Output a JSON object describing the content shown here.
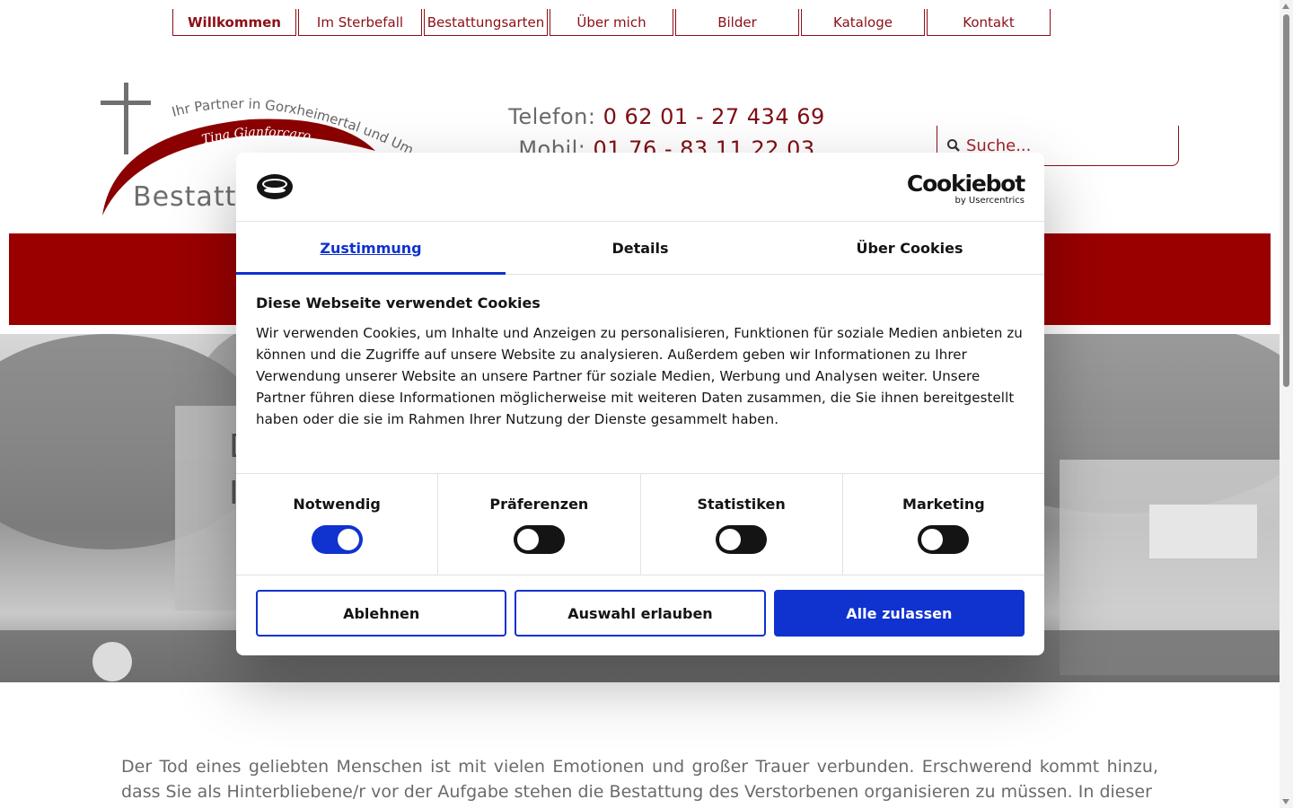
{
  "nav": {
    "items": [
      {
        "label": "Willkommen",
        "active": true
      },
      {
        "label": "Im Sterbefall",
        "active": false
      },
      {
        "label": "Bestattungsarten",
        "active": false
      },
      {
        "label": "Über mich",
        "active": false
      },
      {
        "label": "Bilder",
        "active": false
      },
      {
        "label": "Kataloge",
        "active": false
      },
      {
        "label": "Kontakt",
        "active": false
      }
    ]
  },
  "header": {
    "logo_tagline": "Ihr Partner in Gorxheimertal und Umgeb",
    "logo_name": "Tina Gianforcaro",
    "logo_title": "Bestattu",
    "phone_label": "Telefon:",
    "phone_number": "0 62 01 - 27 434 69",
    "mobile_label": "Mobil:",
    "mobile_number": "01 76 - 83 11 22 03",
    "search_placeholder": "Suche..."
  },
  "hero": {
    "line1": "D",
    "line2": "I"
  },
  "intro": "Der Tod eines geliebten Menschen ist mit vielen Emotionen und großer Trauer verbunden. Erschwerend kommt hinzu, dass Sie als Hinterbliebene/r vor der Aufgabe stehen die Bestattung des Verstorbenen organisieren zu müssen. In dieser",
  "cookie": {
    "brand_name": "Cookiebot",
    "brand_sub": "by Usercentrics",
    "tabs": [
      {
        "label": "Zustimmung",
        "active": true
      },
      {
        "label": "Details",
        "active": false
      },
      {
        "label": "Über Cookies",
        "active": false
      }
    ],
    "title": "Diese Webseite verwendet Cookies",
    "text": "Wir verwenden Cookies, um Inhalte und Anzeigen zu personalisieren, Funktionen für soziale Medien anbieten zu können und die Zugriffe auf unsere Website zu analysieren. Außerdem geben wir Informationen zu Ihrer Verwendung unserer Website an unsere Partner für soziale Medien, Werbung und Analysen weiter. Unsere Partner führen diese Informationen möglicherweise mit weiteren Daten zusammen, die Sie ihnen bereitgestellt haben oder die sie im Rahmen Ihrer Nutzung der Dienste gesammelt haben.",
    "toggles": [
      {
        "label": "Notwendig",
        "on": true
      },
      {
        "label": "Präferenzen",
        "on": false
      },
      {
        "label": "Statistiken",
        "on": false
      },
      {
        "label": "Marketing",
        "on": false
      }
    ],
    "buttons": {
      "decline": "Ablehnen",
      "allow_selection": "Auswahl erlauben",
      "allow_all": "Alle zulassen"
    }
  },
  "colors": {
    "brand_red": "#8b0f16",
    "band_red": "#9b0000",
    "cookie_blue": "#1032cf"
  }
}
